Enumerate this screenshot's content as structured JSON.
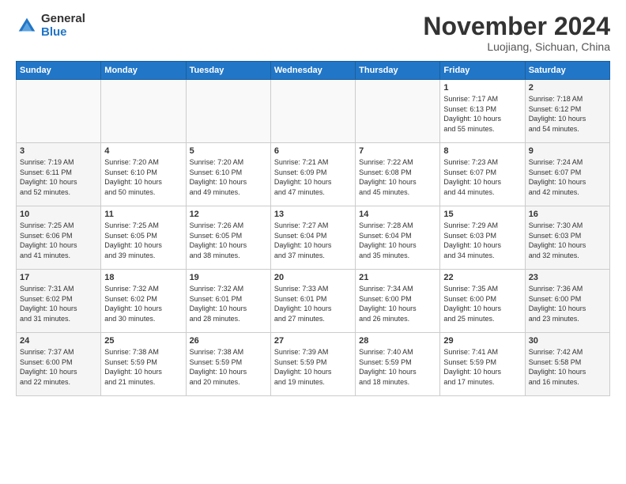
{
  "header": {
    "logo_general": "General",
    "logo_blue": "Blue",
    "month": "November 2024",
    "location": "Luojiang, Sichuan, China"
  },
  "weekdays": [
    "Sunday",
    "Monday",
    "Tuesday",
    "Wednesday",
    "Thursday",
    "Friday",
    "Saturday"
  ],
  "weeks": [
    [
      {
        "day": "",
        "info": ""
      },
      {
        "day": "",
        "info": ""
      },
      {
        "day": "",
        "info": ""
      },
      {
        "day": "",
        "info": ""
      },
      {
        "day": "",
        "info": ""
      },
      {
        "day": "1",
        "info": "Sunrise: 7:17 AM\nSunset: 6:13 PM\nDaylight: 10 hours\nand 55 minutes."
      },
      {
        "day": "2",
        "info": "Sunrise: 7:18 AM\nSunset: 6:12 PM\nDaylight: 10 hours\nand 54 minutes."
      }
    ],
    [
      {
        "day": "3",
        "info": "Sunrise: 7:19 AM\nSunset: 6:11 PM\nDaylight: 10 hours\nand 52 minutes."
      },
      {
        "day": "4",
        "info": "Sunrise: 7:20 AM\nSunset: 6:10 PM\nDaylight: 10 hours\nand 50 minutes."
      },
      {
        "day": "5",
        "info": "Sunrise: 7:20 AM\nSunset: 6:10 PM\nDaylight: 10 hours\nand 49 minutes."
      },
      {
        "day": "6",
        "info": "Sunrise: 7:21 AM\nSunset: 6:09 PM\nDaylight: 10 hours\nand 47 minutes."
      },
      {
        "day": "7",
        "info": "Sunrise: 7:22 AM\nSunset: 6:08 PM\nDaylight: 10 hours\nand 45 minutes."
      },
      {
        "day": "8",
        "info": "Sunrise: 7:23 AM\nSunset: 6:07 PM\nDaylight: 10 hours\nand 44 minutes."
      },
      {
        "day": "9",
        "info": "Sunrise: 7:24 AM\nSunset: 6:07 PM\nDaylight: 10 hours\nand 42 minutes."
      }
    ],
    [
      {
        "day": "10",
        "info": "Sunrise: 7:25 AM\nSunset: 6:06 PM\nDaylight: 10 hours\nand 41 minutes."
      },
      {
        "day": "11",
        "info": "Sunrise: 7:25 AM\nSunset: 6:05 PM\nDaylight: 10 hours\nand 39 minutes."
      },
      {
        "day": "12",
        "info": "Sunrise: 7:26 AM\nSunset: 6:05 PM\nDaylight: 10 hours\nand 38 minutes."
      },
      {
        "day": "13",
        "info": "Sunrise: 7:27 AM\nSunset: 6:04 PM\nDaylight: 10 hours\nand 37 minutes."
      },
      {
        "day": "14",
        "info": "Sunrise: 7:28 AM\nSunset: 6:04 PM\nDaylight: 10 hours\nand 35 minutes."
      },
      {
        "day": "15",
        "info": "Sunrise: 7:29 AM\nSunset: 6:03 PM\nDaylight: 10 hours\nand 34 minutes."
      },
      {
        "day": "16",
        "info": "Sunrise: 7:30 AM\nSunset: 6:03 PM\nDaylight: 10 hours\nand 32 minutes."
      }
    ],
    [
      {
        "day": "17",
        "info": "Sunrise: 7:31 AM\nSunset: 6:02 PM\nDaylight: 10 hours\nand 31 minutes."
      },
      {
        "day": "18",
        "info": "Sunrise: 7:32 AM\nSunset: 6:02 PM\nDaylight: 10 hours\nand 30 minutes."
      },
      {
        "day": "19",
        "info": "Sunrise: 7:32 AM\nSunset: 6:01 PM\nDaylight: 10 hours\nand 28 minutes."
      },
      {
        "day": "20",
        "info": "Sunrise: 7:33 AM\nSunset: 6:01 PM\nDaylight: 10 hours\nand 27 minutes."
      },
      {
        "day": "21",
        "info": "Sunrise: 7:34 AM\nSunset: 6:00 PM\nDaylight: 10 hours\nand 26 minutes."
      },
      {
        "day": "22",
        "info": "Sunrise: 7:35 AM\nSunset: 6:00 PM\nDaylight: 10 hours\nand 25 minutes."
      },
      {
        "day": "23",
        "info": "Sunrise: 7:36 AM\nSunset: 6:00 PM\nDaylight: 10 hours\nand 23 minutes."
      }
    ],
    [
      {
        "day": "24",
        "info": "Sunrise: 7:37 AM\nSunset: 6:00 PM\nDaylight: 10 hours\nand 22 minutes."
      },
      {
        "day": "25",
        "info": "Sunrise: 7:38 AM\nSunset: 5:59 PM\nDaylight: 10 hours\nand 21 minutes."
      },
      {
        "day": "26",
        "info": "Sunrise: 7:38 AM\nSunset: 5:59 PM\nDaylight: 10 hours\nand 20 minutes."
      },
      {
        "day": "27",
        "info": "Sunrise: 7:39 AM\nSunset: 5:59 PM\nDaylight: 10 hours\nand 19 minutes."
      },
      {
        "day": "28",
        "info": "Sunrise: 7:40 AM\nSunset: 5:59 PM\nDaylight: 10 hours\nand 18 minutes."
      },
      {
        "day": "29",
        "info": "Sunrise: 7:41 AM\nSunset: 5:59 PM\nDaylight: 10 hours\nand 17 minutes."
      },
      {
        "day": "30",
        "info": "Sunrise: 7:42 AM\nSunset: 5:58 PM\nDaylight: 10 hours\nand 16 minutes."
      }
    ]
  ]
}
